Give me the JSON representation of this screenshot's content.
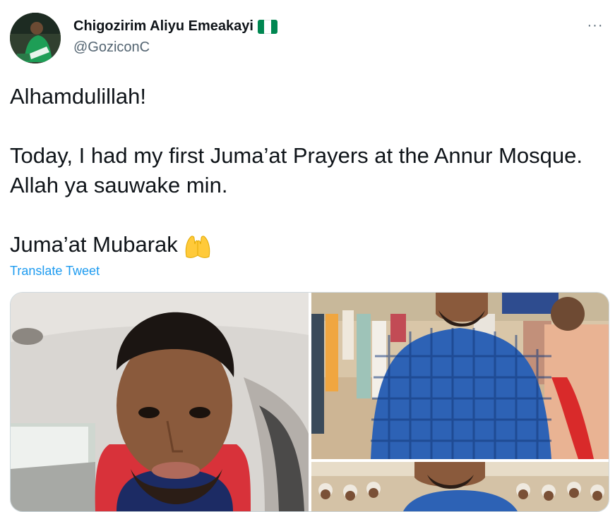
{
  "author": {
    "name": "Chigozirim Aliyu Emeakayi",
    "handle": "@GoziconC",
    "avatar_icon": "profile-photo",
    "flag_emoji": "nigeria-flag",
    "flag_colors": [
      "#008751",
      "#ffffff",
      "#008751"
    ]
  },
  "more_menu": {
    "label": "···",
    "icon": "more-horizontal-icon"
  },
  "tweet": {
    "line1": "Alhamdulillah!",
    "line2": "Today, I had my first Juma’at Prayers at the Annur Mosque. Allah ya sauwake min.",
    "line3": "Juma’at Mubarak",
    "emoji": "raising-hands-emoji"
  },
  "translate_label": "Translate Tweet",
  "colors": {
    "link": "#1d9bf0",
    "secondary_text": "#536471"
  },
  "media": [
    {
      "icon": "selfie-in-car-photo"
    },
    {
      "icon": "man-in-blue-shirt-outdoors-photo"
    },
    {
      "icon": "crowd-at-mosque-photo"
    }
  ]
}
